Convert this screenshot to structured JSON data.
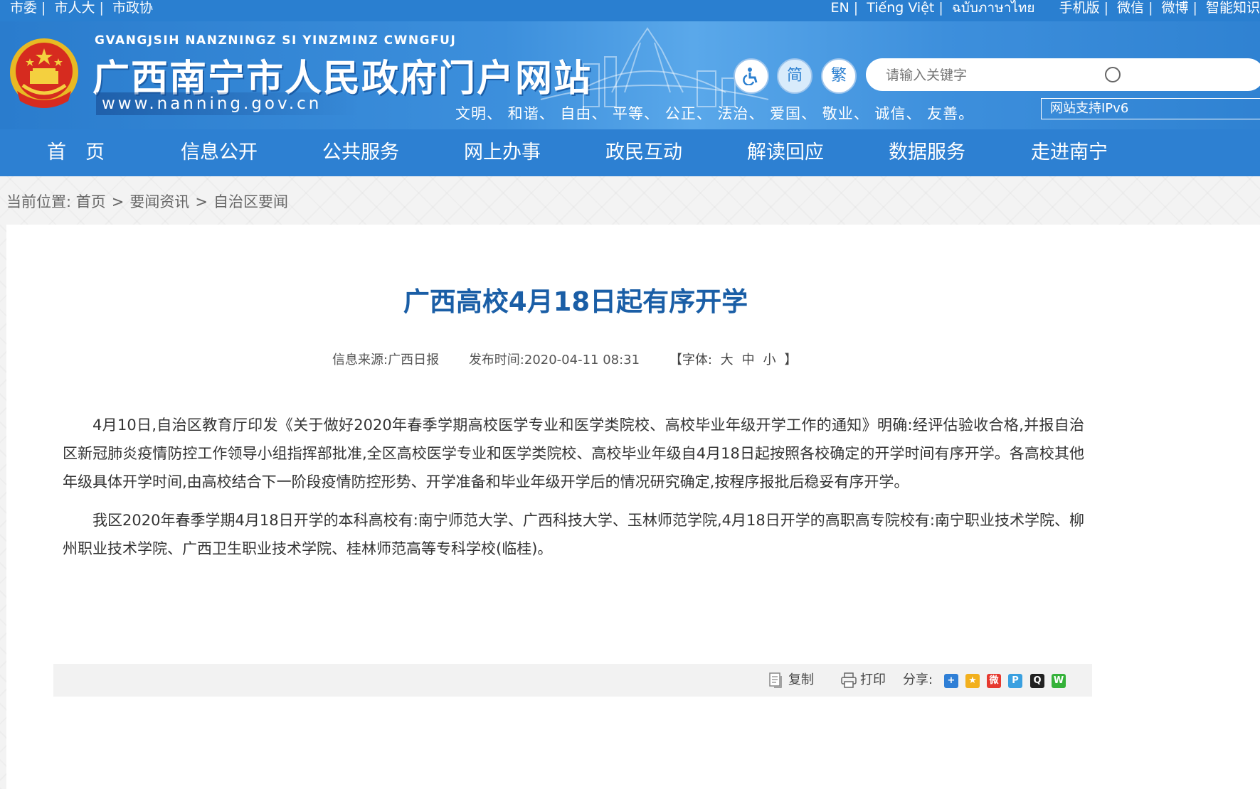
{
  "topbar": {
    "left_links": [
      "市委",
      "市人大",
      "市政协"
    ],
    "right_links": [
      "EN",
      "Tiếng Việt",
      "ฉบับภาษาไทย",
      "手机版",
      "微信",
      "微博",
      "智能知识"
    ]
  },
  "header": {
    "pinyin": "GVANGJSIH NANZNINGZ SI YINZMINZ CWNGFUJ",
    "title": "广西南宁市人民政府门户网站",
    "url": "www.nanning.gov.cn",
    "accessibility_icon": "wheelchair-icon",
    "simplified_label": "简",
    "traditional_label": "繁",
    "search_placeholder": "请输入关键字",
    "core_values": "文明、 和谐、 自由、 平等、 公正、 法治、 爱国、 敬业、 诚信、 友善。",
    "ipv6_label": "网站支持IPv6"
  },
  "nav": {
    "items": [
      "首　页",
      "信息公开",
      "公共服务",
      "网上办事",
      "政民互动",
      "解读回应",
      "数据服务",
      "走进南宁"
    ]
  },
  "breadcrumb": {
    "prefix": "当前位置:",
    "items": [
      "首页",
      "要闻资讯",
      "自治区要闻"
    ]
  },
  "article": {
    "title": "广西高校4月18日起有序开学",
    "source": "信息来源:广西日报",
    "published": "发布时间:2020-04-11 08:31",
    "font_size_label": "【字体:",
    "font_size_options": [
      "大",
      "中",
      "小"
    ],
    "font_size_close": "】",
    "paragraphs": [
      "4月10日,自治区教育厅印发《关于做好2020年春季学期高校医学专业和医学类院校、高校毕业年级开学工作的通知》明确:经评估验收合格,并报自治区新冠肺炎疫情防控工作领导小组指挥部批准,全区高校医学专业和医学类院校、高校毕业年级自4月18日起按照各校确定的开学时间有序开学。各高校其他年级具体开学时间,由高校结合下一阶段疫情防控形势、开学准备和毕业年级开学后的情况研究确定,按程序报批后稳妥有序开学。",
      "我区2020年春季学期4月18日开学的本科高校有:南宁师范大学、广西科技大学、玉林师范学院,4月18日开学的高职高专院校有:南宁职业技术学院、柳州职业技术学院、广西卫生职业技术学院、桂林师范高等专科学校(临桂)。"
    ]
  },
  "toolbar": {
    "copy_label": "复制",
    "print_label": "打印",
    "share_label": "分享:",
    "share_icons": [
      "qzone-plus-icon",
      "qzone-star-icon",
      "weibo-icon",
      "tencent-icon",
      "qq-icon",
      "wechat-icon"
    ]
  },
  "colors": {
    "primary": "#2d80d2",
    "title": "#1a5ea6"
  }
}
